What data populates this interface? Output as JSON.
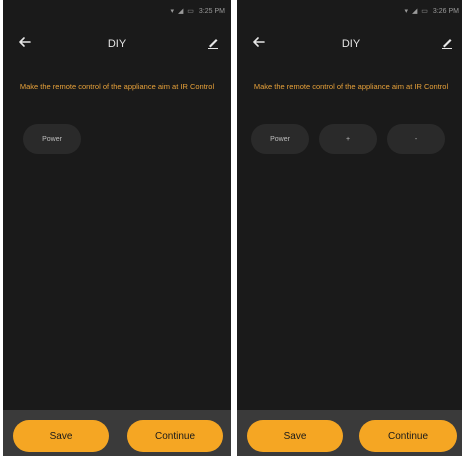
{
  "screens": [
    {
      "status_time": "3:25 PM",
      "title": "DIY",
      "instruction": "Make the remote control of the appliance aim at IR Control",
      "keys": [
        "Power"
      ],
      "save_label": "Save",
      "continue_label": "Continue"
    },
    {
      "status_time": "3:26 PM",
      "title": "DIY",
      "instruction": "Make the remote control of the appliance aim at IR Control",
      "keys": [
        "Power",
        "+",
        "-"
      ],
      "save_label": "Save",
      "continue_label": "Continue"
    }
  ],
  "colors": {
    "background": "#1a1a1a",
    "accent": "#f5a623",
    "instruction_text": "#e8a23a",
    "bottom_bar": "#3a3a3a",
    "key_background": "#2a2a2a"
  },
  "icons": {
    "back": "arrow-left-icon",
    "edit": "pencil-icon"
  }
}
